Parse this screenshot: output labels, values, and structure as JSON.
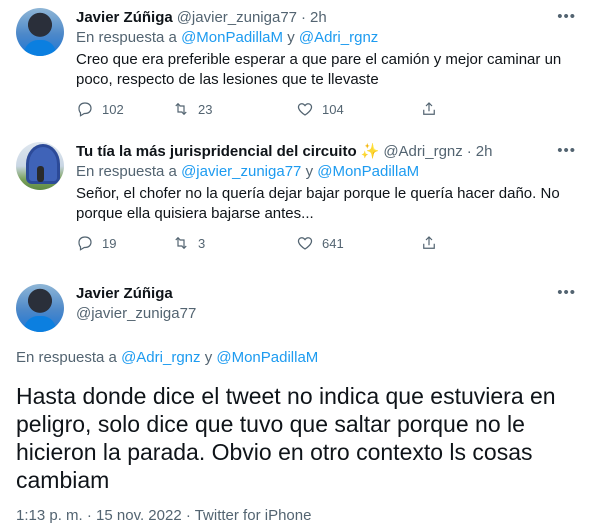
{
  "tweets": [
    {
      "name": "Javier Zúñiga",
      "handle": "@javier_zuniga77",
      "dot": "·",
      "time": "2h",
      "reply_prefix": "En respuesta a",
      "reply_a": "@MonPadillaM",
      "reply_and": "y",
      "reply_b": "@Adri_rgnz",
      "text": "Creo que era preferible esperar a que pare el camión y mejor caminar un poco, respecto de las lesiones que te llevaste",
      "replies": "102",
      "retweets": "23",
      "likes": "104"
    },
    {
      "name": "Tu tía la más jurispridencial del circuito",
      "sparkle": "✨",
      "handle": "@Adri_rgnz",
      "dot": "·",
      "time": "2h",
      "reply_prefix": "En respuesta a",
      "reply_a": "@javier_zuniga77",
      "reply_and": "y",
      "reply_b": "@MonPadillaM",
      "text": "Señor, el chofer no la quería dejar bajar porque le quería hacer daño. No porque ella quisiera bajarse antes...",
      "replies": "19",
      "retweets": "3",
      "likes": "641"
    }
  ],
  "main": {
    "name": "Javier Zúñiga",
    "handle": "@javier_zuniga77",
    "reply_prefix": "En respuesta a",
    "reply_a": "@Adri_rgnz",
    "reply_and": "y",
    "reply_b": "@MonPadillaM",
    "text": "Hasta donde dice el tweet no indica que estuviera en peligro, solo dice que tuvo que saltar porque no le hicieron la parada. Obvio en otro contexto ls cosas cambiam",
    "meta": "1:13 p. m. · 15 nov. 2022 · Twitter for iPhone"
  },
  "icons": {
    "more": "more-dots-icon",
    "reply": "reply-icon",
    "retweet": "retweet-icon",
    "like": "heart-icon",
    "share": "share-icon"
  },
  "colors": {
    "link": "#1d9bf0",
    "secondary": "#536471",
    "text": "#0f1419"
  }
}
